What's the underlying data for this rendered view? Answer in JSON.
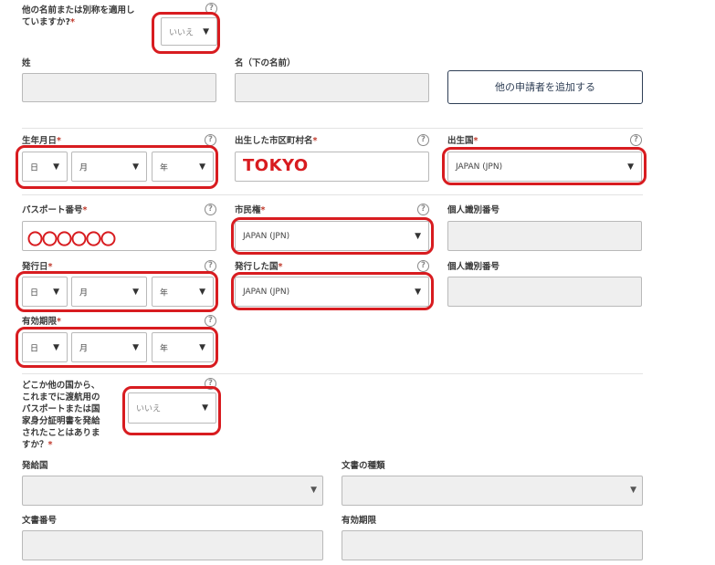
{
  "alias": {
    "question": "他の名前または別称を適用し",
    "question_line2": "ていますか?",
    "required": "*",
    "value": "いいえ"
  },
  "names": {
    "surname_label": "姓",
    "given_label": "名（下の名前）",
    "add_applicant_button": "他の申請者を追加する"
  },
  "birth": {
    "date_label": "生年月日",
    "day": "日",
    "month": "月",
    "year": "年",
    "city_label": "出生した市区町村名",
    "city_value": "TOKYO",
    "country_label": "出生国",
    "country_value": "JAPAN (JPN)"
  },
  "passport": {
    "number_label": "パスポート番号",
    "number_value": "〇〇〇〇〇〇",
    "citizenship_label": "市民権",
    "citizenship_value": "JAPAN (JPN)",
    "personal_id_label": "個人識別番号",
    "issue_date_label": "発行日",
    "issuing_country_label": "発行した国",
    "issuing_country_value": "JAPAN (JPN)",
    "personal_id_label2": "個人識別番号",
    "expiry_label": "有効期限",
    "day": "日",
    "month": "月",
    "year": "年"
  },
  "other_passport": {
    "question_lines": [
      "どこか他の国から、",
      "これまでに渡航用の",
      "パスポートまたは国",
      "家身分証明書を発給",
      "されたことはありま",
      "すか？"
    ],
    "value": "いいえ",
    "issuing_country_label": "発給国",
    "document_type_label": "文書の種類",
    "document_number_label": "文書番号",
    "expiry_label": "有効期限"
  },
  "help_glyph": "?",
  "dropdown_arrow": "▼",
  "colors": {
    "highlight": "#d81c20",
    "disabled_field": "#efefef",
    "border": "#b9b9b9"
  }
}
